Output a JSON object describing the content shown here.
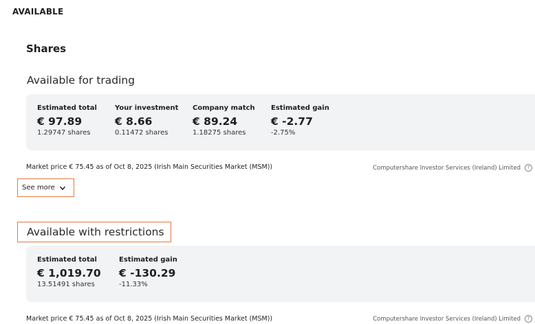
{
  "section": {
    "heading": "AVAILABLE"
  },
  "group": {
    "title": "Shares"
  },
  "trading": {
    "title": "Available for trading",
    "metrics": [
      {
        "label": "Estimated total",
        "value": "€ 97.89",
        "sub": "1.29747 shares"
      },
      {
        "label": "Your investment",
        "value": "€ 8.66",
        "sub": "0.11472 shares"
      },
      {
        "label": "Company match",
        "value": "€ 89.24",
        "sub": "1.18275 shares"
      },
      {
        "label": "Estimated gain",
        "value": "€ -2.77",
        "sub": "-2.75%"
      }
    ],
    "market_price": "Market price € 75.45 as of Oct 8, 2025 (Irish Main Securities Market (MSM))",
    "provider": "Computershare Investor Services (Ireland) Limited",
    "see_more_label": "See more"
  },
  "restricted": {
    "title": "Available with restrictions",
    "metrics": [
      {
        "label": "Estimated total",
        "value": "€ 1,019.70",
        "sub": "13.51491 shares"
      },
      {
        "label": "Estimated gain",
        "value": "€ -130.29",
        "sub": "-11.33%"
      }
    ],
    "market_price": "Market price € 75.45 as of Oct 8, 2025 (Irish Main Securities Market (MSM))",
    "provider": "Computershare Investor Services (Ireland) Limited"
  },
  "icons": {
    "help": "question-circle-icon",
    "chevron": "chevron-down-icon"
  },
  "colors": {
    "highlight_border": "#e07a3f",
    "card_bg": "#f1f3f5"
  }
}
